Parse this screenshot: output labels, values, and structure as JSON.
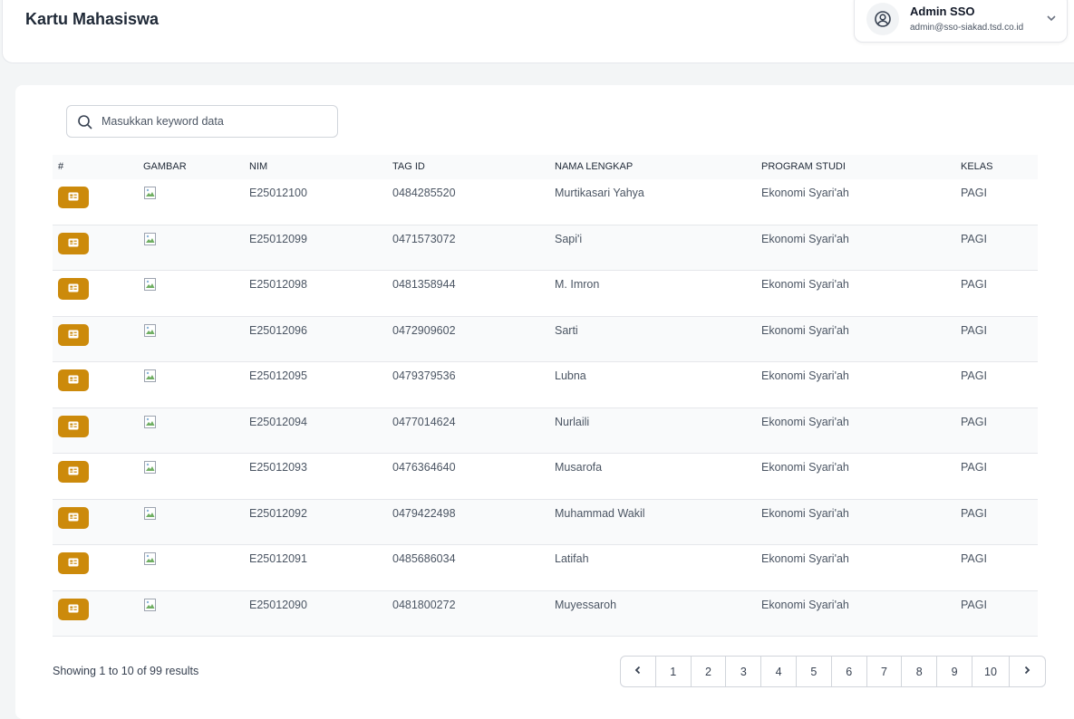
{
  "header": {
    "title": "Kartu Mahasiswa",
    "user": {
      "name": "Admin SSO",
      "email": "admin@sso-siakad.tsd.co.id"
    }
  },
  "search": {
    "placeholder": "Masukkan keyword data",
    "value": ""
  },
  "table": {
    "columns": [
      "#",
      "GAMBAR",
      "NIM",
      "TAG ID",
      "NAMA LENGKAP",
      "PROGRAM STUDI",
      "KELAS"
    ],
    "rows": [
      {
        "nim": "E25012100",
        "tag_id": "0484285520",
        "nama": "Murtikasari Yahya",
        "prodi": "Ekonomi Syari'ah",
        "kelas": "PAGI"
      },
      {
        "nim": "E25012099",
        "tag_id": "0471573072",
        "nama": "Sapi'i",
        "prodi": "Ekonomi Syari'ah",
        "kelas": "PAGI"
      },
      {
        "nim": "E25012098",
        "tag_id": "0481358944",
        "nama": "M. Imron",
        "prodi": "Ekonomi Syari'ah",
        "kelas": "PAGI"
      },
      {
        "nim": "E25012096",
        "tag_id": "0472909602",
        "nama": "Sarti",
        "prodi": "Ekonomi Syari'ah",
        "kelas": "PAGI"
      },
      {
        "nim": "E25012095",
        "tag_id": "0479379536",
        "nama": "Lubna",
        "prodi": "Ekonomi Syari'ah",
        "kelas": "PAGI"
      },
      {
        "nim": "E25012094",
        "tag_id": "0477014624",
        "nama": "Nurlaili",
        "prodi": "Ekonomi Syari'ah",
        "kelas": "PAGI"
      },
      {
        "nim": "E25012093",
        "tag_id": "0476364640",
        "nama": "Musarofa",
        "prodi": "Ekonomi Syari'ah",
        "kelas": "PAGI"
      },
      {
        "nim": "E25012092",
        "tag_id": "0479422498",
        "nama": "Muhammad Wakil",
        "prodi": "Ekonomi Syari'ah",
        "kelas": "PAGI"
      },
      {
        "nim": "E25012091",
        "tag_id": "0485686034",
        "nama": "Latifah",
        "prodi": "Ekonomi Syari'ah",
        "kelas": "PAGI"
      },
      {
        "nim": "E25012090",
        "tag_id": "0481800272",
        "nama": "Muyessaroh",
        "prodi": "Ekonomi Syari'ah",
        "kelas": "PAGI"
      }
    ],
    "card_button_icon": "id-card-icon",
    "image_icon": "broken-image-icon"
  },
  "footer": {
    "results_text": "Showing 1 to 10 of 99 results",
    "pages": [
      "1",
      "2",
      "3",
      "4",
      "5",
      "6",
      "7",
      "8",
      "9",
      "10"
    ],
    "prev_icon": "chevron-left-icon",
    "next_icon": "chevron-right-icon"
  },
  "colors": {
    "accent": "#cc8a0b",
    "header_bg": "#f9fafb",
    "border": "#e5e7eb"
  }
}
